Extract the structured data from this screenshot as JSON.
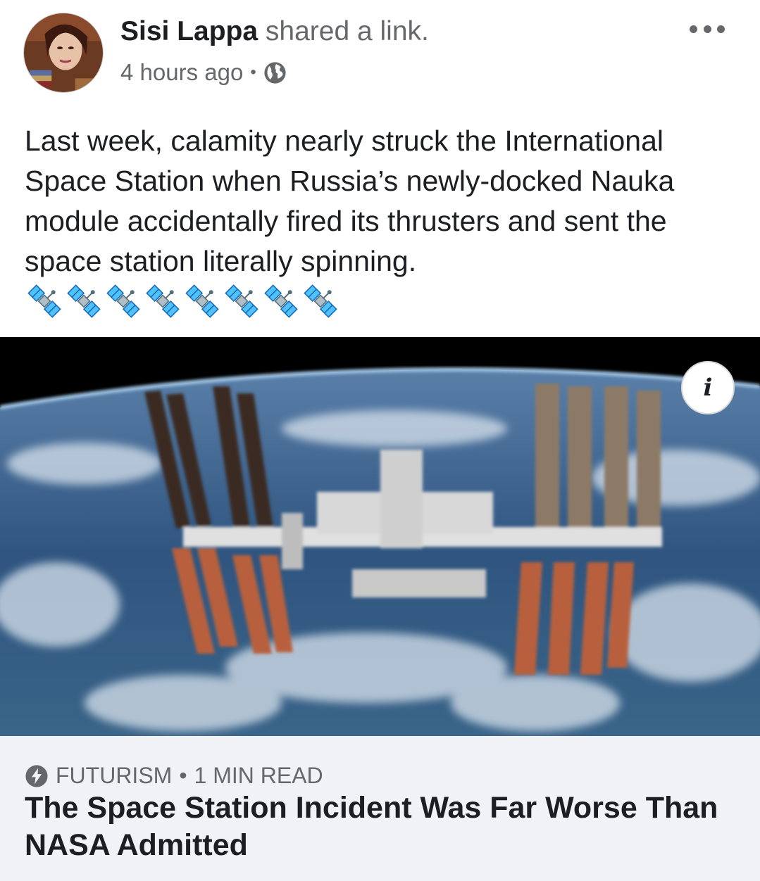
{
  "post": {
    "author": "Sisi Lappa",
    "action": " shared a link.",
    "time": "4 hours ago",
    "separator": "•",
    "privacy_icon": "globe-icon",
    "menu_icon": "more-options-icon",
    "text": "Last week, calamity nearly struck the International Space Station when Russia’s newly-docked Nauka module accidentally fired its thrusters and sent the space station literally spinning.",
    "emoji": [
      "🛰️",
      "🛰️",
      "🛰️",
      "🛰️",
      "🛰️",
      "🛰️",
      "🛰️",
      "🛰️"
    ]
  },
  "link": {
    "info_label": "i",
    "source_icon": "lightning-bolt-icon",
    "source": "FUTURISM",
    "separator": "•",
    "read_time": "1 MIN READ",
    "title": "The Space Station Incident Was Far Worse Than NASA Admitted"
  },
  "colors": {
    "text_primary": "#1c1e21",
    "text_secondary": "#65676b",
    "footer_bg": "#f0f2f5"
  }
}
